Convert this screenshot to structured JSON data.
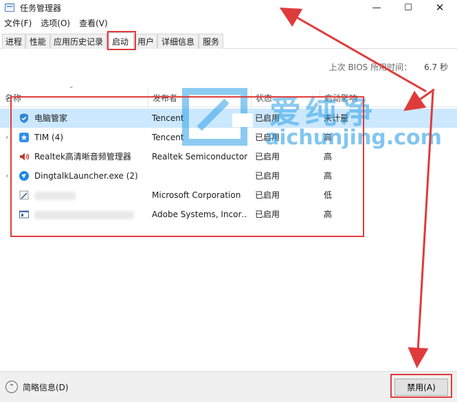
{
  "window": {
    "title": "任务管理器",
    "min_glyph": "—",
    "max_glyph": "☐",
    "close_glyph": "✕"
  },
  "menu": [
    "文件(F)",
    "选项(O)",
    "查看(V)"
  ],
  "tabs": [
    "进程",
    "性能",
    "应用历史记录",
    "启动",
    "用户",
    "详细信息",
    "服务"
  ],
  "active_tab": "启动",
  "boot_time": {
    "label": "上次 BIOS 所用时间：",
    "value": "6.7 秒"
  },
  "columns": [
    "名称",
    "发布者",
    "状态",
    "启动影响"
  ],
  "rows": [
    {
      "name": "电脑管家",
      "publisher": "Tencent",
      "status": "已启用",
      "impact": "未计量",
      "icon": "shield-icon",
      "expandable": false,
      "selected": true
    },
    {
      "name": "TIM (4)",
      "publisher": "Tencent",
      "status": "已启用",
      "impact": "高",
      "icon": "tim-icon",
      "expandable": true,
      "selected": false
    },
    {
      "name": "Realtek高清晰音频管理器",
      "publisher": "Realtek Semiconductor",
      "status": "已启用",
      "impact": "高",
      "icon": "speaker-icon",
      "expandable": false,
      "selected": false
    },
    {
      "name": "DingtalkLauncher.exe (2)",
      "publisher": "",
      "status": "已启用",
      "impact": "高",
      "icon": "dingtalk-icon",
      "expandable": true,
      "selected": false
    },
    {
      "name": "",
      "publisher": "Microsoft Corporation",
      "status": "已启用",
      "impact": "低",
      "icon": "pen-icon",
      "expandable": false,
      "selected": false
    },
    {
      "name": "",
      "publisher": "Adobe Systems, Incor…",
      "status": "已启用",
      "impact": "高",
      "icon": "app-window-icon",
      "expandable": false,
      "selected": false
    }
  ],
  "footer": {
    "fewer_details": "简略信息(D)",
    "disable_button": "禁用(A)"
  },
  "watermark": {
    "text": "爱纯净",
    "url": "aichunjing.com"
  },
  "colors": {
    "annotation_red": "#e03b3b",
    "selection": "#cce8ff",
    "watermark_blue": "#2ea0e6"
  }
}
